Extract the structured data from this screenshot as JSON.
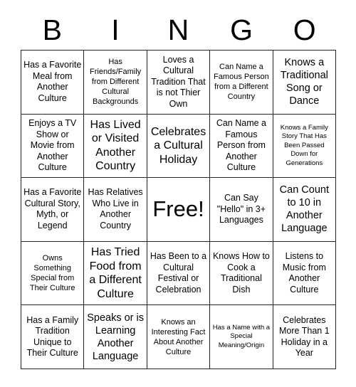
{
  "card": {
    "header_letters": [
      "B",
      "I",
      "N",
      "G",
      "O"
    ],
    "rows": [
      [
        {
          "text": "Has a Favorite Meal from Another Culture",
          "size": "m"
        },
        {
          "text": "Has Friends/Family from Different Cultural Backgrounds",
          "size": "s"
        },
        {
          "text": "Loves a Cultural Tradition That is not Thier Own",
          "size": "m"
        },
        {
          "text": "Can Name a Famous Person from a Different Country",
          "size": "s"
        },
        {
          "text": "Knows a Traditional Song or Dance",
          "size": "l"
        }
      ],
      [
        {
          "text": "Enjoys a TV Show or Movie from Another Culture",
          "size": "m"
        },
        {
          "text": "Has Lived or Visited Another Country",
          "size": "xl"
        },
        {
          "text": "Celebrates a Cultural Holiday",
          "size": "xl"
        },
        {
          "text": "Can Name a Famous Person from Another Culture",
          "size": "m"
        },
        {
          "text": "Knows a Family Story That Has Been Passed Down for Generations",
          "size": "xs"
        }
      ],
      [
        {
          "text": "Has a Favorite Cultural Story, Myth, or Legend",
          "size": "m"
        },
        {
          "text": "Has Relatives Who Live in Another Country",
          "size": "m"
        },
        {
          "text": "Free!",
          "size": "free"
        },
        {
          "text": "Can Say \"Hello\" in 3+ Languages",
          "size": "m"
        },
        {
          "text": "Can Count to 10 in Another Language",
          "size": "l"
        }
      ],
      [
        {
          "text": "Owns Something Special from Their Culture",
          "size": "s"
        },
        {
          "text": "Has Tried Food from a Different Culture",
          "size": "xl"
        },
        {
          "text": "Has Been to a Cultural Festival or Celebration",
          "size": "m"
        },
        {
          "text": "Knows How to Cook a Traditional Dish",
          "size": "m"
        },
        {
          "text": "Listens to Music from Another Culture",
          "size": "m"
        }
      ],
      [
        {
          "text": "Has a Family Tradition Unique to Their Culture",
          "size": "m"
        },
        {
          "text": "Speaks or is Learning Another Language",
          "size": "l"
        },
        {
          "text": "Knows an Interesting Fact About Another Culture",
          "size": "s"
        },
        {
          "text": "Has a Name with a Special Meaning/Origin",
          "size": "xs"
        },
        {
          "text": "Celebrates More Than 1 Holiday in a Year",
          "size": "m"
        }
      ]
    ]
  }
}
